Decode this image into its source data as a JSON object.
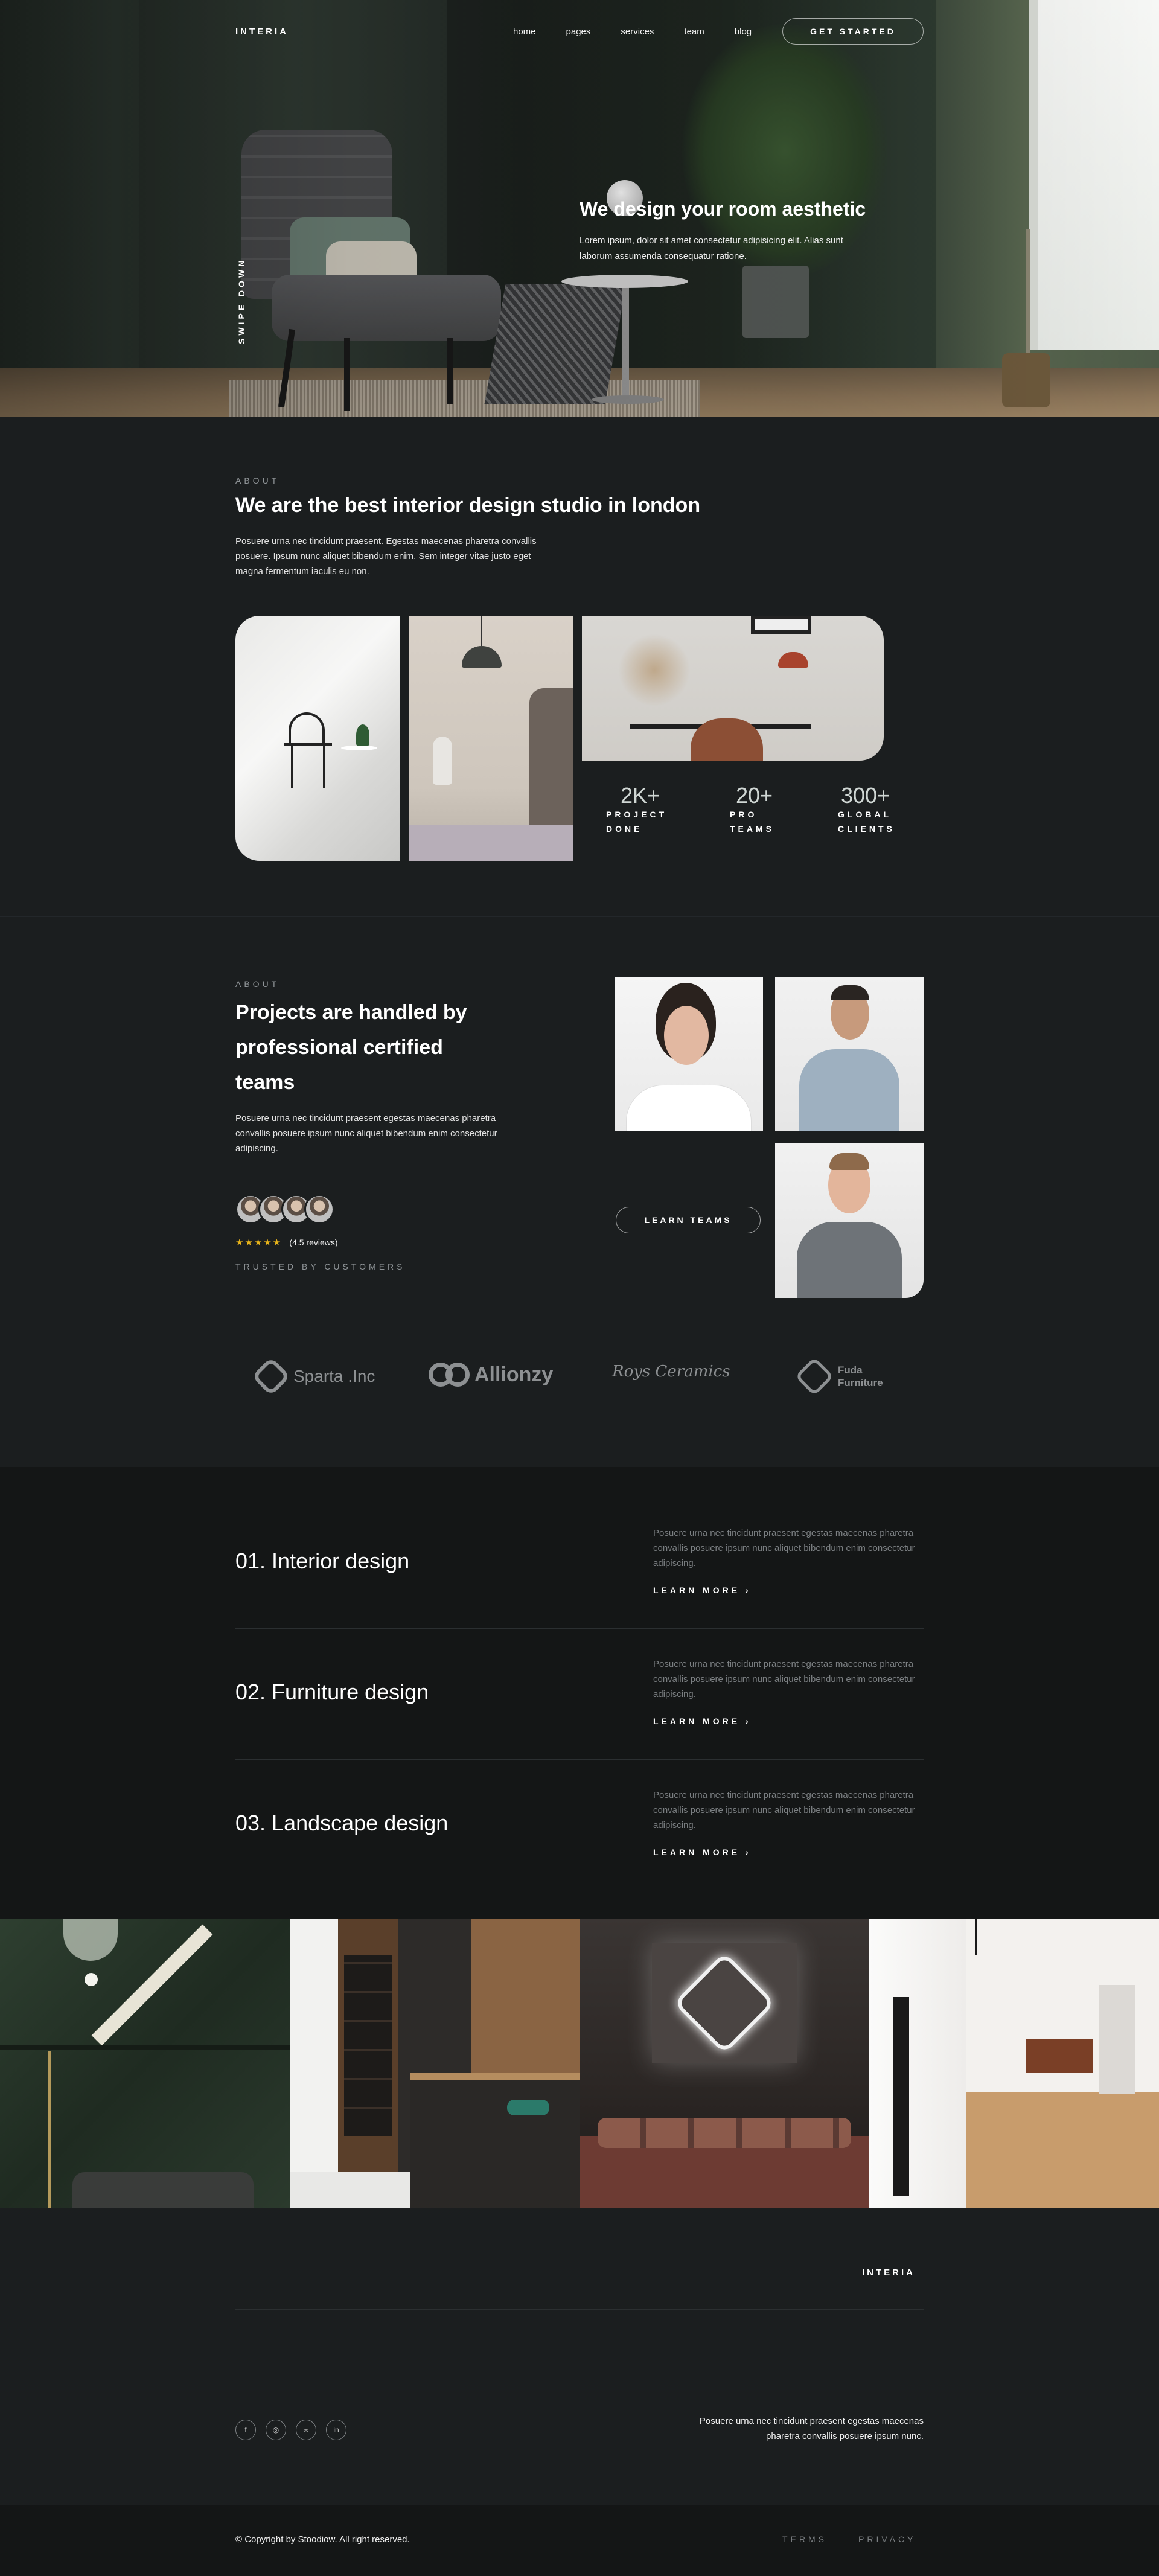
{
  "nav": {
    "logo": "INTERIA",
    "menu": [
      "home",
      "pages",
      "services",
      "team",
      "blog"
    ],
    "cta": "GET STARTED"
  },
  "hero": {
    "title": "We design your room aesthetic",
    "subtitle": "Lorem ipsum, dolor sit amet consectetur adipisicing elit. Alias sunt laborum assumenda consequatur ratione.",
    "swipe": "SWIPE DOWN"
  },
  "about": {
    "eyebrow": "ABOUT",
    "title": "We are the best interior design studio in london",
    "text": "Posuere urna nec tincidunt praesent. Egestas maecenas pharetra convallis posuere. Ipsum nunc aliquet bibendum enim. Sem integer vitae justo eget magna fermentum iaculis eu non.",
    "stats": [
      {
        "value": "2K+",
        "label_1": "PROJECT",
        "label_2": "DONE"
      },
      {
        "value": "20+",
        "label_1": "PRO",
        "label_2": "TEAMS"
      },
      {
        "value": "300+",
        "label_1": "GLOBAL",
        "label_2": "CLIENTS"
      }
    ]
  },
  "team": {
    "eyebrow": "ABOUT",
    "title_line_1": "Projects are handled by",
    "title_line_2": "professional certified",
    "title_line_3": "teams",
    "text": "Posuere urna nec tincidunt praesent egestas maecenas pharetra convallis posuere ipsum nunc aliquet bibendum enim consectetur adipiscing.",
    "rating_stars": "★★★★★",
    "rating": 4.5,
    "reviews": "(4.5 reviews)",
    "trusted": "TRUSTED BY CUSTOMERS",
    "button": "LEARN TEAMS"
  },
  "brands": {
    "sparta": "Sparta .Inc",
    "allionzy": "Allionzy",
    "roys": "Roys Ceramics",
    "fuda_1": "Fuda",
    "fuda_2": "Furniture"
  },
  "services": [
    {
      "title": "01. Interior design",
      "text": "Posuere urna nec tincidunt praesent egestas maecenas pharetra convallis posuere ipsum nunc aliquet bibendum enim consectetur adipiscing.",
      "link": "LEARN MORE ›"
    },
    {
      "title": "02. Furniture design",
      "text": "Posuere urna nec tincidunt praesent egestas maecenas pharetra convallis posuere ipsum nunc aliquet bibendum enim consectetur adipiscing.",
      "link": "LEARN MORE ›"
    },
    {
      "title": "03. Landscape design",
      "text": "Posuere urna nec tincidunt praesent egestas maecenas pharetra convallis posuere ipsum nunc aliquet bibendum enim consectetur adipiscing.",
      "link": "LEARN MORE ›"
    }
  ],
  "footer": {
    "logo": "INTERIA",
    "text_line_1": "Posuere urna nec tincidunt praesent egestas maecenas",
    "text_line_2": "pharetra convallis posuere ipsum nunc.",
    "social": [
      "f",
      "◎",
      "∞",
      "in"
    ],
    "copyright": "© Copyright by Stoodiow. All right reserved.",
    "terms": "TERMS",
    "privacy": "PRIVACY"
  },
  "colors": {
    "background": "#1b1e1f",
    "services_bg": "#141616",
    "star": "#e7b31a",
    "muted": "#7b7f82"
  }
}
